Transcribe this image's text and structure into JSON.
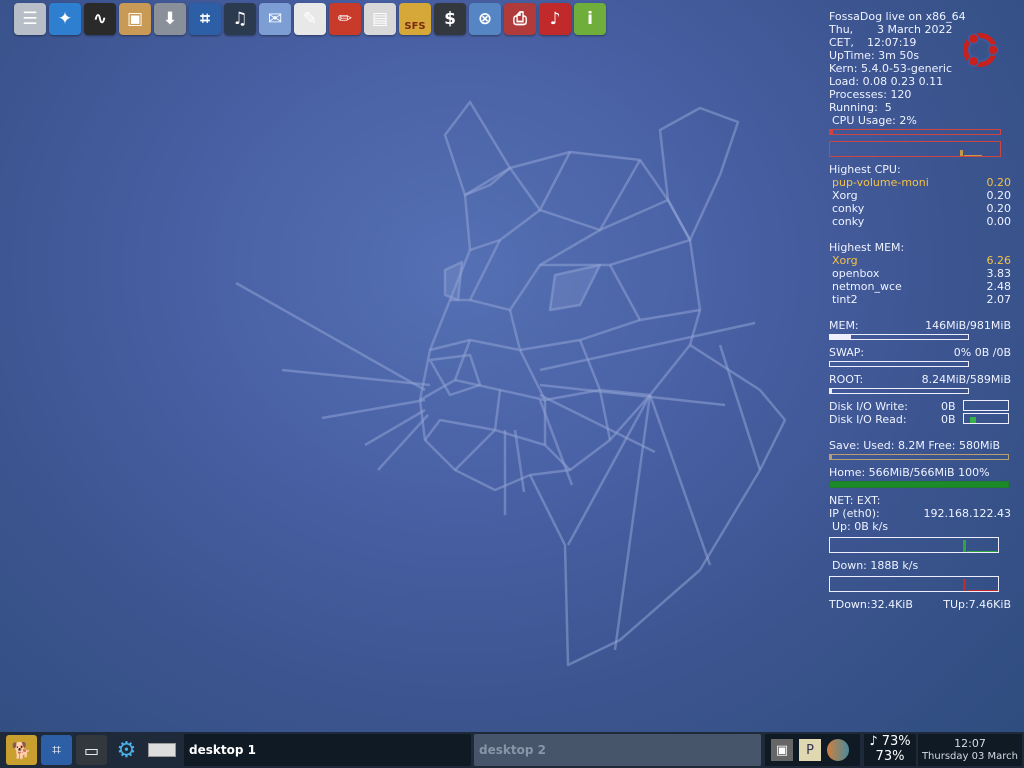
{
  "launcher": [
    {
      "name": "mixer-icon",
      "color": "#b8bec8",
      "glyph": "☰"
    },
    {
      "name": "compass-browser-icon",
      "color": "#2f7fd0",
      "glyph": "✦"
    },
    {
      "name": "system-monitor-icon",
      "color": "#2a2a2a",
      "glyph": "∿"
    },
    {
      "name": "package-manager-icon",
      "color": "#c99a55",
      "glyph": "▣"
    },
    {
      "name": "download-icon",
      "color": "#8a9099",
      "glyph": "⬇"
    },
    {
      "name": "terminal-icon",
      "color": "#2d5fa6",
      "glyph": "⌗"
    },
    {
      "name": "headphones-icon",
      "color": "#2c3a4f",
      "glyph": "♫"
    },
    {
      "name": "media-player-icon",
      "color": "#7d9ed4",
      "glyph": "✉"
    },
    {
      "name": "text-editor-icon",
      "color": "#e8e8e8",
      "glyph": "✎"
    },
    {
      "name": "graphics-pencils-icon",
      "color": "#c83a2a",
      "glyph": "✏"
    },
    {
      "name": "file-cabinet-icon",
      "color": "#d8d8d8",
      "glyph": "▤"
    },
    {
      "name": "sfs-loader-icon",
      "color": "#d6a83a",
      "glyph": "SFS"
    },
    {
      "name": "console-icon",
      "color": "#33373e",
      "glyph": "$"
    },
    {
      "name": "network-settings-icon",
      "color": "#5585c2",
      "glyph": "⊗"
    },
    {
      "name": "printer-icon",
      "color": "#b13a3a",
      "glyph": "⎙"
    },
    {
      "name": "music-player-icon",
      "color": "#c02a2a",
      "glyph": "♪"
    },
    {
      "name": "info-icon",
      "color": "#6fae3a",
      "glyph": "i"
    }
  ],
  "conky": {
    "title": "FossaDog live on x86_64",
    "date_row": [
      "Thu,",
      "3 March 2022"
    ],
    "time_row": [
      "CET,",
      "12:07:19"
    ],
    "uptime_label": "UpTime:",
    "uptime": "3m 50s",
    "kern_label": "Kern:",
    "kern": "5.4.0-53-generic",
    "load_label": "Load:",
    "load": "0.08 0.23 0.11",
    "processes_label": "Processes:",
    "processes": "120",
    "running_label": "Running:",
    "running": "5",
    "cpu_usage_label": "CPU Usage:",
    "cpu_usage": "2%",
    "cpu_usage_fraction": 0.02,
    "highest_cpu_title": "Highest CPU:",
    "highest_cpu": [
      {
        "name": "pup-volume-moni",
        "value": "0.20"
      },
      {
        "name": "Xorg",
        "value": "0.20"
      },
      {
        "name": "conky",
        "value": "0.20"
      },
      {
        "name": "conky",
        "value": "0.00"
      }
    ],
    "highest_mem_title": "Highest MEM:",
    "highest_mem": [
      {
        "name": "Xorg",
        "value": "6.26"
      },
      {
        "name": "openbox",
        "value": "3.83"
      },
      {
        "name": "netmon_wce",
        "value": "2.48"
      },
      {
        "name": "tint2",
        "value": "2.07"
      }
    ],
    "mem_label": "MEM:",
    "mem": "146MiB/981MiB",
    "mem_fraction": 0.149,
    "swap_label": "SWAP:",
    "swap": "0% 0B  /0B",
    "swap_fraction": 0,
    "root_label": "ROOT:",
    "root": "8.24MiB/589MiB",
    "root_fraction": 0.014,
    "disk_write_label": "Disk I/O Write:",
    "disk_write": "0B",
    "disk_read_label": "Disk I/O Read:",
    "disk_read": "0B",
    "save": "Save: Used: 8.2M Free: 580MiB",
    "save_fraction": 0.014,
    "home": "Home: 566MiB/566MiB 100%",
    "home_fraction": 1.0,
    "net_title": "NET: EXT:",
    "ip_label": "IP (eth0):",
    "ip": "192.168.122.43",
    "up": "Up: 0B  k/s",
    "down": "Down: 188B  k/s",
    "tdown": "TDown:32.4KiB",
    "tup": "TUp:7.46KiB"
  },
  "taskbar": {
    "desktop1": "desktop 1",
    "desktop2": "desktop 2",
    "volume_top": "♪ 73%",
    "volume_bottom": "73%",
    "clock_time": "12:07",
    "clock_date": "Thursday 03 March"
  }
}
